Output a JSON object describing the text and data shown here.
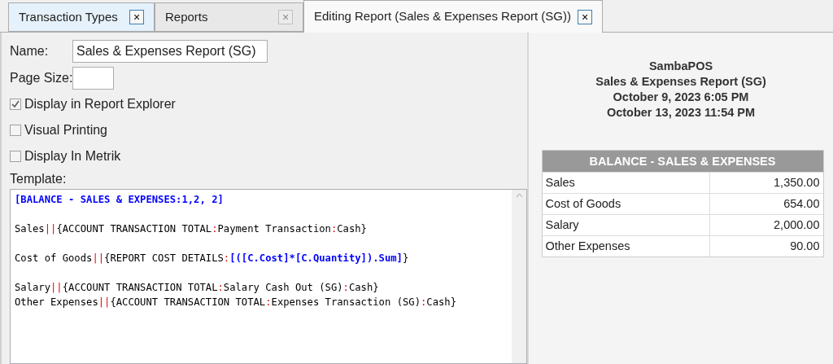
{
  "tabs": [
    {
      "label": "Transaction Types",
      "selected": false,
      "hovered": true,
      "close": "×"
    },
    {
      "label": "Reports",
      "selected": false,
      "hovered": false,
      "close": "×"
    },
    {
      "label": "Editing Report (Sales & Expenses Report (SG))",
      "selected": true,
      "hovered": false,
      "close": "×"
    }
  ],
  "form": {
    "name_label": "Name:",
    "name_value": "Sales & Expenses Report (SG)",
    "page_size_label": "Page Size:",
    "checkboxes": [
      {
        "label": "Display in Report Explorer",
        "checked": true
      },
      {
        "label": "Visual Printing",
        "checked": false
      },
      {
        "label": "Display In Metrik",
        "checked": false
      }
    ],
    "template_label": "Template:",
    "template_lines": [
      {
        "kind": "text",
        "segments": [
          {
            "text": "[BALANCE - SALES & EXPENSES:1,2, 2]",
            "kind": "keyword"
          }
        ]
      },
      {
        "kind": "blank"
      },
      {
        "kind": "text",
        "segments": [
          {
            "text": "Sales",
            "kind": "plain"
          },
          {
            "text": "||",
            "kind": "separator"
          },
          {
            "text": "{ACCOUNT TRANSACTION TOTAL",
            "kind": "plain"
          },
          {
            "text": ":",
            "kind": "separator"
          },
          {
            "text": "Payment Transaction",
            "kind": "plain"
          },
          {
            "text": ":",
            "kind": "separator"
          },
          {
            "text": "Cash}",
            "kind": "plain"
          }
        ]
      },
      {
        "kind": "blank"
      },
      {
        "kind": "text",
        "segments": [
          {
            "text": "Cost of Goods",
            "kind": "plain"
          },
          {
            "text": "||",
            "kind": "separator"
          },
          {
            "text": "{REPORT COST DETAILS",
            "kind": "plain"
          },
          {
            "text": ":",
            "kind": "separator"
          },
          {
            "text": "[([C.Cost]*[C.Quantity]).Sum]",
            "kind": "keyword"
          },
          {
            "text": "}",
            "kind": "plain"
          }
        ]
      },
      {
        "kind": "blank"
      },
      {
        "kind": "text",
        "segments": [
          {
            "text": "Salary",
            "kind": "plain"
          },
          {
            "text": "||",
            "kind": "separator"
          },
          {
            "text": "{ACCOUNT TRANSACTION TOTAL",
            "kind": "plain"
          },
          {
            "text": ":",
            "kind": "separator"
          },
          {
            "text": "Salary Cash Out (SG)",
            "kind": "plain"
          },
          {
            "text": ":",
            "kind": "separator"
          },
          {
            "text": "Cash}",
            "kind": "plain"
          }
        ]
      },
      {
        "kind": "text",
        "segments": [
          {
            "text": "Other Expenses",
            "kind": "plain"
          },
          {
            "text": "||",
            "kind": "separator"
          },
          {
            "text": "{ACCOUNT TRANSACTION TOTAL",
            "kind": "plain"
          },
          {
            "text": ":",
            "kind": "separator"
          },
          {
            "text": "Expenses Transaction (SG)",
            "kind": "plain"
          },
          {
            "text": ":",
            "kind": "separator"
          },
          {
            "text": "Cash}",
            "kind": "plain"
          }
        ]
      }
    ]
  },
  "preview": {
    "header_lines": [
      "SambaPOS",
      "Sales & Expenses Report (SG)",
      "October 9, 2023 6:05 PM",
      "October 13, 2023 11:54 PM"
    ],
    "table": {
      "title": "BALANCE - SALES & EXPENSES",
      "rows": [
        {
          "label": "Sales",
          "value": "1,350.00"
        },
        {
          "label": "Cost of Goods",
          "value": "654.00"
        },
        {
          "label": "Salary",
          "value": "2,000.00"
        },
        {
          "label": "Other Expenses",
          "value": "90.00"
        }
      ]
    }
  }
}
